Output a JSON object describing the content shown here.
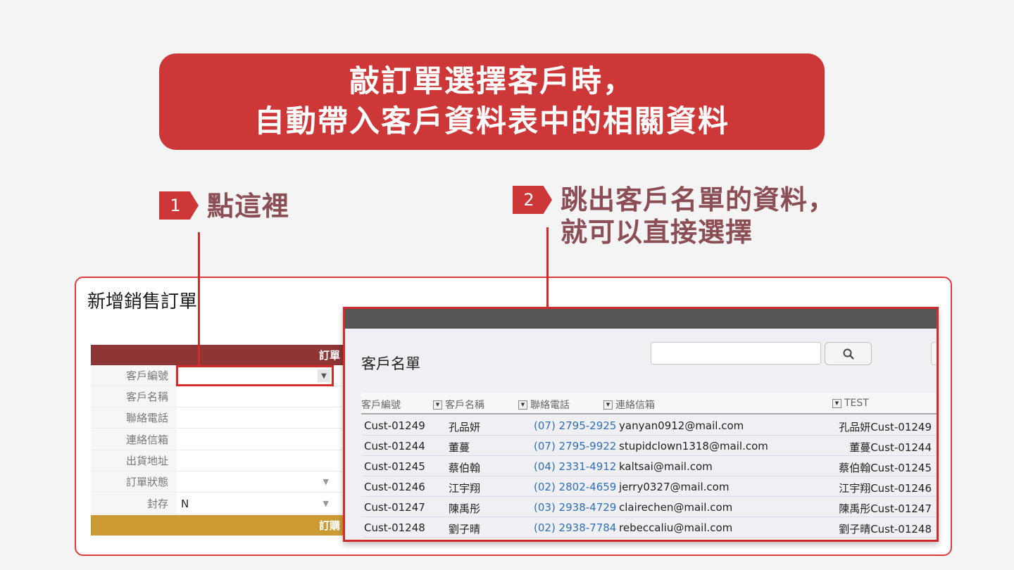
{
  "banner": {
    "line1": "敲訂單選擇客戶時，",
    "line2": "自動帶入客戶資料表中的相關資料"
  },
  "steps": [
    {
      "num": "1",
      "line1": "點這裡",
      "line2": ""
    },
    {
      "num": "2",
      "line1": "跳出客戶名單的資料，",
      "line2": "就可以直接選擇"
    }
  ],
  "form": {
    "title": "新增銷售訂單",
    "section1": "訂單",
    "section2": "訂購",
    "fields": [
      {
        "label": "客戶編號",
        "value": ""
      },
      {
        "label": "客戶名稱",
        "value": ""
      },
      {
        "label": "聯絡電話",
        "value": ""
      },
      {
        "label": "連絡信箱",
        "value": ""
      },
      {
        "label": "出貨地址",
        "value": ""
      },
      {
        "label": "訂單狀態",
        "value": ""
      },
      {
        "label": "封存",
        "value": "N"
      }
    ]
  },
  "popup": {
    "title": "客戶名單",
    "search_placeholder": "",
    "columns": [
      "客戶編號",
      "客戶名稱",
      "聯絡電話",
      "連絡信箱",
      "TEST"
    ],
    "rows": [
      [
        "Cust-01249",
        "孔品妍",
        "(07) 2795-2925",
        "yanyan0912@mail.com",
        "孔品妍Cust-01249"
      ],
      [
        "Cust-01244",
        "董蔓",
        "(07) 2795-9922",
        "stupidclown1318@mail.com",
        "董蔓Cust-01244"
      ],
      [
        "Cust-01245",
        "蔡伯翰",
        "(04) 2331-4912",
        "kaltsai@mail.com",
        "蔡伯翰Cust-01245"
      ],
      [
        "Cust-01246",
        "江宇翔",
        "(02) 2802-4659",
        "jerry0327@mail.com",
        "江宇翔Cust-01246"
      ],
      [
        "Cust-01247",
        "陳禹彤",
        "(03) 2938-4729",
        "clairechen@mail.com",
        "陳禹彤Cust-01247"
      ],
      [
        "Cust-01248",
        "劉子晴",
        "(02) 2938-7784",
        "rebeccaliu@mail.com",
        "劉子晴Cust-01248"
      ]
    ]
  },
  "colors": {
    "accent_red": "#cd3737",
    "section1_bg": "#8e3535",
    "section2_bg": "#cc9a33",
    "step_text": "#8a4e54",
    "link_blue": "#2f6fb5"
  }
}
